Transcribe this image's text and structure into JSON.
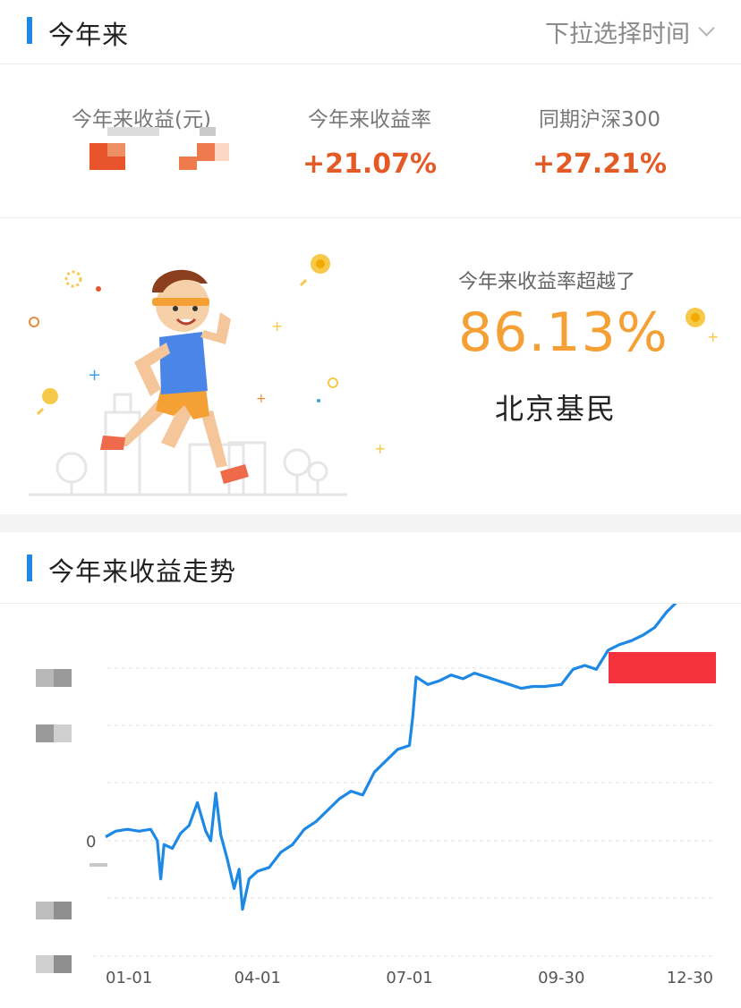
{
  "header": {
    "title": "今年来",
    "time_select": "下拉选择时间"
  },
  "stats": [
    {
      "label": "今年来收益(元)",
      "value": ""
    },
    {
      "label": "今年来收益率",
      "value": "+21.07%"
    },
    {
      "label": "同期沪深300",
      "value": "+27.21%"
    }
  ],
  "ranking": {
    "label": "今年来收益率超越了",
    "value": "86.13%",
    "city": "北京基民"
  },
  "trend": {
    "title": "今年来收益走势"
  },
  "colors": {
    "accent": "#1e88e5",
    "gain": "#e35a25",
    "rank": "#f5a035",
    "line": "#1e88e5"
  },
  "chart_data": {
    "type": "line",
    "x_ticks": [
      "01-01",
      "04-01",
      "07-01",
      "09-30",
      "12-30"
    ],
    "y_tick_labels": [
      "0"
    ],
    "series": [
      {
        "points": [
          [
            "01-01",
            0.2
          ],
          [
            "01-07",
            0.5
          ],
          [
            "01-14",
            0.6
          ],
          [
            "01-21",
            0.5
          ],
          [
            "01-28",
            0.6
          ],
          [
            "02-01",
            0.0
          ],
          [
            "02-03",
            -2.0
          ],
          [
            "02-05",
            -0.2
          ],
          [
            "02-10",
            -0.4
          ],
          [
            "02-15",
            0.4
          ],
          [
            "02-20",
            0.8
          ],
          [
            "02-25",
            2.0
          ],
          [
            "03-01",
            0.5
          ],
          [
            "03-04",
            0.0
          ],
          [
            "03-07",
            2.5
          ],
          [
            "03-10",
            0.3
          ],
          [
            "03-14",
            -1.0
          ],
          [
            "03-18",
            -2.5
          ],
          [
            "03-21",
            -1.5
          ],
          [
            "03-23",
            -3.6
          ],
          [
            "03-27",
            -2.0
          ],
          [
            "04-01",
            -1.6
          ],
          [
            "04-08",
            -1.4
          ],
          [
            "04-15",
            -0.6
          ],
          [
            "04-22",
            -0.2
          ],
          [
            "04-29",
            0.6
          ],
          [
            "05-06",
            1.0
          ],
          [
            "05-13",
            1.6
          ],
          [
            "05-20",
            2.2
          ],
          [
            "05-27",
            2.6
          ],
          [
            "06-03",
            2.4
          ],
          [
            "06-10",
            3.6
          ],
          [
            "06-17",
            4.2
          ],
          [
            "06-24",
            4.8
          ],
          [
            "07-01",
            5.0
          ],
          [
            "07-03",
            6.5
          ],
          [
            "07-05",
            8.6
          ],
          [
            "07-12",
            8.2
          ],
          [
            "07-19",
            8.4
          ],
          [
            "07-26",
            8.7
          ],
          [
            "08-02",
            8.5
          ],
          [
            "08-09",
            8.8
          ],
          [
            "08-16",
            8.6
          ],
          [
            "08-23",
            8.4
          ],
          [
            "08-30",
            8.2
          ],
          [
            "09-06",
            8.0
          ],
          [
            "09-13",
            8.1
          ],
          [
            "09-20",
            8.1
          ],
          [
            "09-30",
            8.2
          ],
          [
            "10-07",
            9.0
          ],
          [
            "10-14",
            9.2
          ],
          [
            "10-21",
            9.0
          ],
          [
            "10-28",
            10.0
          ],
          [
            "11-04",
            10.3
          ],
          [
            "11-11",
            10.5
          ],
          [
            "11-18",
            10.8
          ],
          [
            "11-25",
            11.2
          ],
          [
            "12-02",
            12.0
          ],
          [
            "12-09",
            12.6
          ],
          [
            "12-16",
            13.4
          ],
          [
            "12-23",
            13.8
          ],
          [
            "12-30",
            14.0
          ]
        ]
      }
    ]
  }
}
